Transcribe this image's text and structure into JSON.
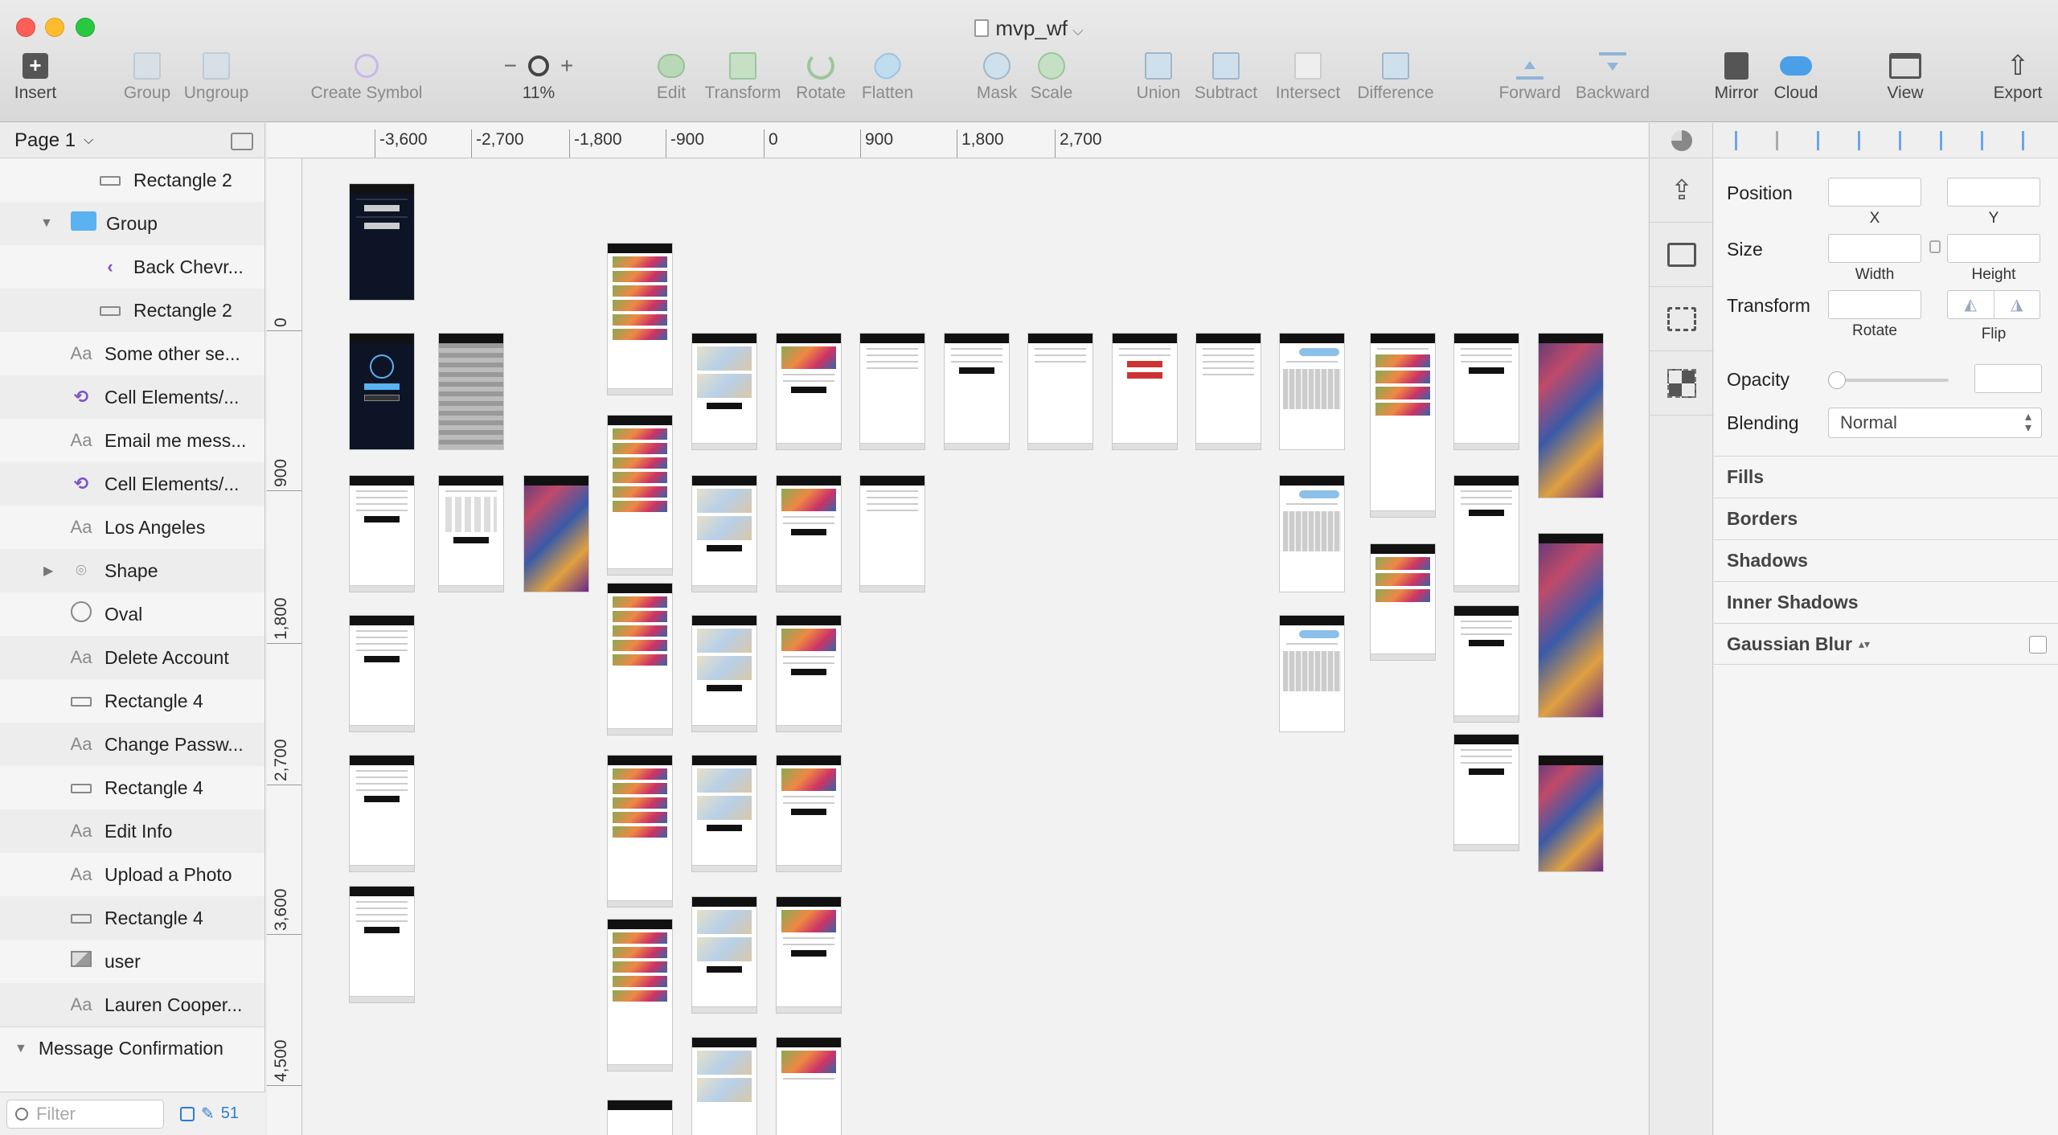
{
  "window": {
    "title": "mvp_wf"
  },
  "toolbar": {
    "insert": "Insert",
    "group": "Group",
    "ungroup": "Ungroup",
    "create_symbol": "Create Symbol",
    "zoom_minus": "−",
    "zoom_plus": "+",
    "zoom": "11%",
    "edit": "Edit",
    "transform": "Transform",
    "rotate": "Rotate",
    "flatten": "Flatten",
    "mask": "Mask",
    "scale": "Scale",
    "union": "Union",
    "subtract": "Subtract",
    "intersect": "Intersect",
    "difference": "Difference",
    "forward": "Forward",
    "backward": "Backward",
    "mirror": "Mirror",
    "cloud": "Cloud",
    "view": "View",
    "export": "Export"
  },
  "sidebar": {
    "page": "Page 1",
    "layers": [
      {
        "label": "Rectangle 2",
        "icon": "rectangle-icon"
      },
      {
        "label": "Group",
        "icon": "folder-icon"
      },
      {
        "label": "Back Chevr...",
        "icon": "chevron-icon"
      },
      {
        "label": "Rectangle 2",
        "icon": "rectangle-icon"
      },
      {
        "label": "Some other se...",
        "icon": "text-icon"
      },
      {
        "label": "Cell Elements/...",
        "icon": "symbol-icon"
      },
      {
        "label": "Email me mess...",
        "icon": "text-icon"
      },
      {
        "label": "Cell Elements/...",
        "icon": "symbol-icon"
      },
      {
        "label": "Los Angeles",
        "icon": "text-icon"
      },
      {
        "label": "Shape",
        "icon": "pin-icon"
      },
      {
        "label": "Oval",
        "icon": "oval-icon"
      },
      {
        "label": "Delete Account",
        "icon": "text-icon"
      },
      {
        "label": "Rectangle 4",
        "icon": "rectangle-icon"
      },
      {
        "label": "Change Passw...",
        "icon": "text-icon"
      },
      {
        "label": "Rectangle 4",
        "icon": "rectangle-icon"
      },
      {
        "label": "Edit Info",
        "icon": "text-icon"
      },
      {
        "label": "Upload a Photo",
        "icon": "text-icon"
      },
      {
        "label": "Rectangle 4",
        "icon": "rectangle-icon"
      },
      {
        "label": "user",
        "icon": "image-icon"
      },
      {
        "label": "Lauren Cooper...",
        "icon": "text-icon"
      }
    ],
    "text_glyph": "Aa",
    "group_header": "Message Confirmation",
    "filter_placeholder": "Filter",
    "count": "51"
  },
  "rulers": {
    "top": [
      "-3,600",
      "-2,700",
      "-1,800",
      "-900",
      "0",
      "900",
      "1,800",
      "2,700"
    ],
    "left": [
      "0",
      "900",
      "1,800",
      "2,700",
      "3,600",
      "4,500"
    ]
  },
  "inspector": {
    "position": "Position",
    "x": "X",
    "y": "Y",
    "size": "Size",
    "width": "Width",
    "height": "Height",
    "transform": "Transform",
    "rotate": "Rotate",
    "flip": "Flip",
    "opacity": "Opacity",
    "blending": "Blending",
    "blending_value": "Normal",
    "sections": [
      "Fills",
      "Borders",
      "Shadows",
      "Inner Shadows",
      "Gaussian Blur"
    ]
  }
}
